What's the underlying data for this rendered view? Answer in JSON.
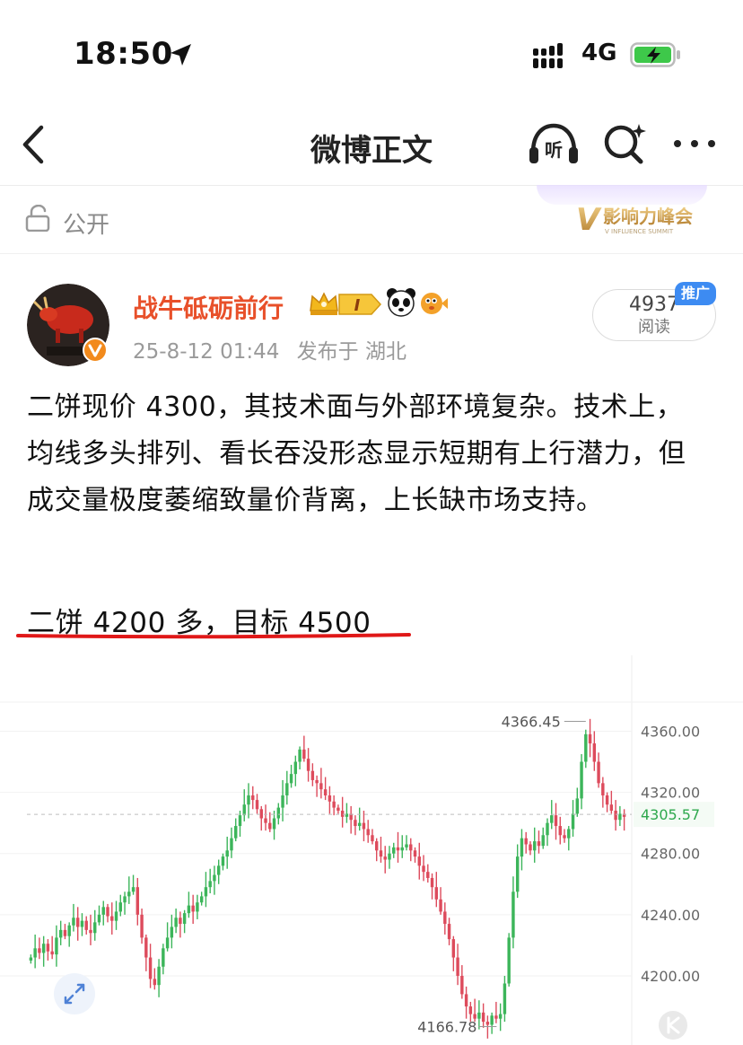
{
  "status_bar": {
    "time": "18:50",
    "network": "4G"
  },
  "nav": {
    "title": "微博正文",
    "listen_label": "听"
  },
  "visibility": {
    "label": "公开",
    "event_logo_text": "影响力峰会",
    "event_logo_letter": "V",
    "event_logo_sub": "V INFLUENCE SUMMIT"
  },
  "user": {
    "name": "战牛砥砺前行",
    "level_badge": "I",
    "post_time": "25-8-12 01:44",
    "location": "发布于 湖北"
  },
  "stats": {
    "reads": "4937",
    "reads_label": "阅读",
    "promo": "推广"
  },
  "post": {
    "body": "二饼现价 4300，其技术面与外部环境复杂。技术上，均线多头排列、看长吞没形态显示短期有上行潜力，但成交量极度萎缩致量价背离，上长缺市场支持。",
    "target": "二饼 4200 多，目标 4500"
  },
  "colors": {
    "up": "#3cb55a",
    "down": "#dd4b5c",
    "accent": "#e8502a",
    "underline": "#e01818",
    "current_price": "#2ea84d"
  },
  "chart_data": {
    "type": "candlestick",
    "y_ticks": [
      "4360.00",
      "4320.00",
      "4280.00",
      "4240.00",
      "4200.00"
    ],
    "ylim": [
      4163,
      4372
    ],
    "current_price": "4305.57",
    "high_label": "4366.45",
    "low_label": "4166.78",
    "closes": [
      4212,
      4218,
      4215,
      4221,
      4216,
      4214,
      4225,
      4230,
      4226,
      4233,
      4238,
      4232,
      4236,
      4230,
      4228,
      4235,
      4240,
      4245,
      4239,
      4236,
      4242,
      4248,
      4252,
      4255,
      4258,
      4240,
      4225,
      4212,
      4198,
      4194,
      4206,
      4218,
      4225,
      4232,
      4238,
      4234,
      4241,
      4246,
      4242,
      4248,
      4252,
      4258,
      4262,
      4266,
      4272,
      4278,
      4282,
      4290,
      4298,
      4305,
      4312,
      4318,
      4315,
      4309,
      4303,
      4300,
      4296,
      4303,
      4310,
      4318,
      4326,
      4332,
      4340,
      4348,
      4342,
      4334,
      4328,
      4326,
      4322,
      4318,
      4314,
      4310,
      4308,
      4304,
      4306,
      4302,
      4298,
      4300,
      4296,
      4292,
      4288,
      4282,
      4278,
      4276,
      4280,
      4284,
      4282,
      4284,
      4286,
      4282,
      4278,
      4272,
      4268,
      4264,
      4258,
      4250,
      4242,
      4234,
      4224,
      4212,
      4200,
      4188,
      4180,
      4175,
      4172,
      4176,
      4170,
      4168,
      4174,
      4172,
      4175,
      4195,
      4225,
      4255,
      4278,
      4290,
      4286,
      4282,
      4288,
      4285,
      4292,
      4300,
      4305,
      4298,
      4292,
      4290,
      4296,
      4306,
      4316,
      4340,
      4358,
      4352,
      4340,
      4326,
      4318,
      4312,
      4308,
      4302,
      4306,
      4304
    ]
  }
}
